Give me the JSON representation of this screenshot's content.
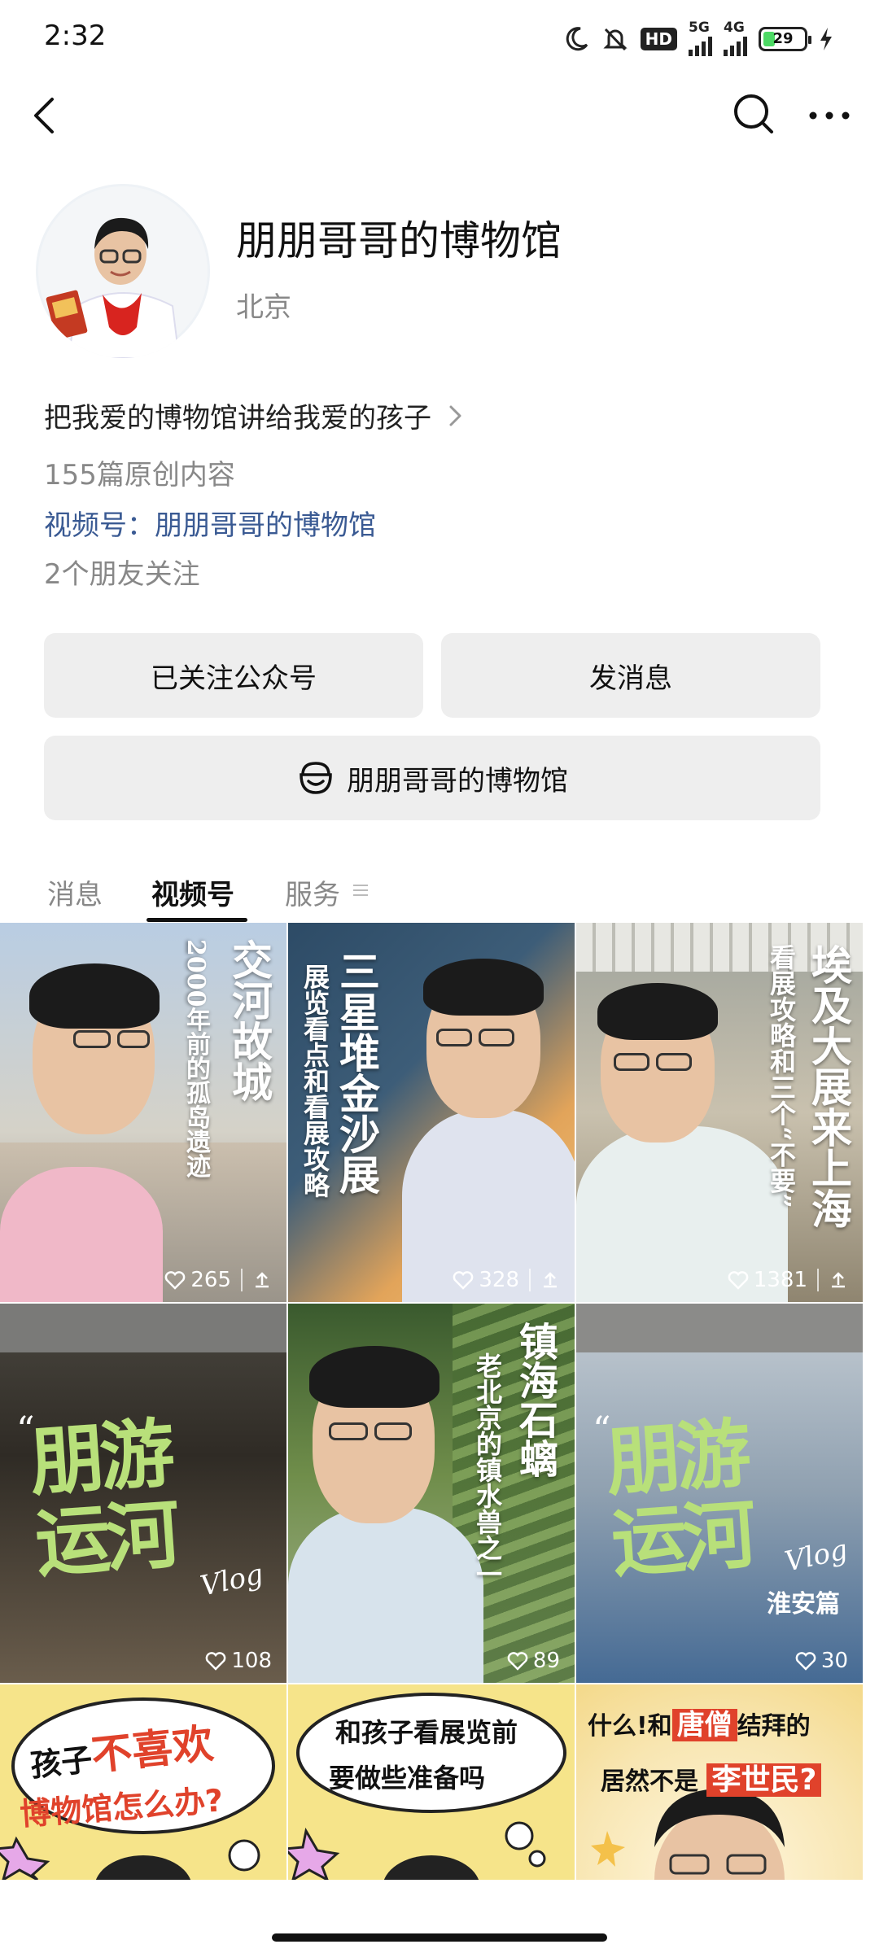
{
  "status_bar": {
    "time": "2:32",
    "network_1": "5G",
    "network_2": "4G",
    "hd_label": "HD",
    "battery_percent": "29",
    "battery_level": 0.29,
    "icons": [
      "moon-icon",
      "bell-off-icon",
      "signal-icon",
      "battery-icon",
      "charging-icon"
    ]
  },
  "nav": {
    "icons": [
      "back-arrow-icon",
      "search-icon",
      "more-icon"
    ]
  },
  "profile": {
    "name": "朋朋哥哥的博物馆",
    "location": "北京",
    "bio": "把我爱的博物馆讲给我爱的孩子",
    "original_count": "155篇原创内容",
    "channel": "视频号：朋朋哥哥的博物馆",
    "friends_following": "2个朋友关注"
  },
  "actions": {
    "followed": "已关注公众号",
    "message": "发消息",
    "shop": "朋朋哥哥的博物馆"
  },
  "tabs": [
    {
      "label": "消息"
    },
    {
      "label": "视频号"
    },
    {
      "label": "服务"
    }
  ],
  "videos": [
    {
      "title": "交河故城",
      "subtitle": "2000年前的孤岛遗迹",
      "likes": "265"
    },
    {
      "title": "三星堆金沙展",
      "subtitle": "展览看点和看展攻略",
      "likes": "328"
    },
    {
      "title": "埃及大展来上海",
      "subtitle": "看展攻略和三个“不要”",
      "likes": "1381"
    },
    {
      "title": "朋游运河",
      "tag": "Vlog",
      "likes": "108"
    },
    {
      "title": "镇海石螭",
      "subtitle": "老北京的镇水兽之一",
      "likes": "89"
    },
    {
      "title": "朋游运河",
      "tag": "Vlog",
      "subtitle": "淮安篇",
      "likes": "30"
    },
    {
      "line1": "孩子",
      "line1b": "不喜欢",
      "line2": "博物馆怎么办?"
    },
    {
      "line1": "和孩子看展览前",
      "line2": "要做些准备吗"
    },
    {
      "line1": "什么!和",
      "line1b": "唐僧",
      "line1c": "结拜的",
      "line2": "居然不是",
      "line2b": "李世民?"
    }
  ],
  "colors": {
    "accent_link": "#3a5a93",
    "button_bg": "#eeeeee",
    "muted_text": "#888888",
    "poster_yellow": "#f6e48a",
    "poster_red": "#e0422b"
  }
}
